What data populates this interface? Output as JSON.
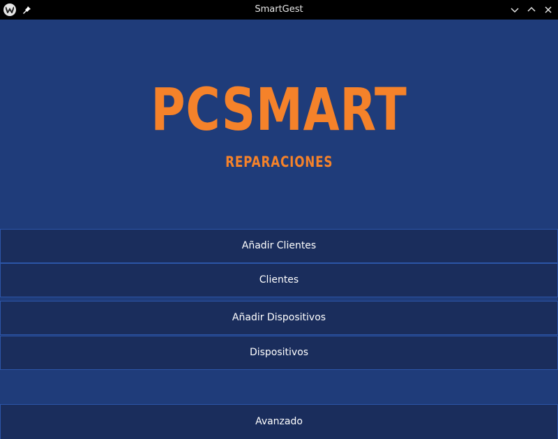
{
  "window": {
    "title": "SmartGest",
    "icons": {
      "app": "app-logo-icon",
      "pin": "pin-icon",
      "minimize": "chevron-down-icon",
      "maximize": "chevron-up-icon",
      "close": "close-icon"
    }
  },
  "logo": {
    "main": "PCSMART",
    "sub": "REPARACIONES"
  },
  "menu": {
    "add_clients": "Añadir Clientes",
    "clients": "Clientes",
    "add_devices": "Añadir Dispositivos",
    "devices": "Dispositivos",
    "advanced": "Avanzado"
  },
  "colors": {
    "background": "#1f3c7a",
    "button": "#1a2d5c",
    "button_border": "#2c55a8",
    "accent": "#f5822a",
    "titlebar": "#000000"
  }
}
